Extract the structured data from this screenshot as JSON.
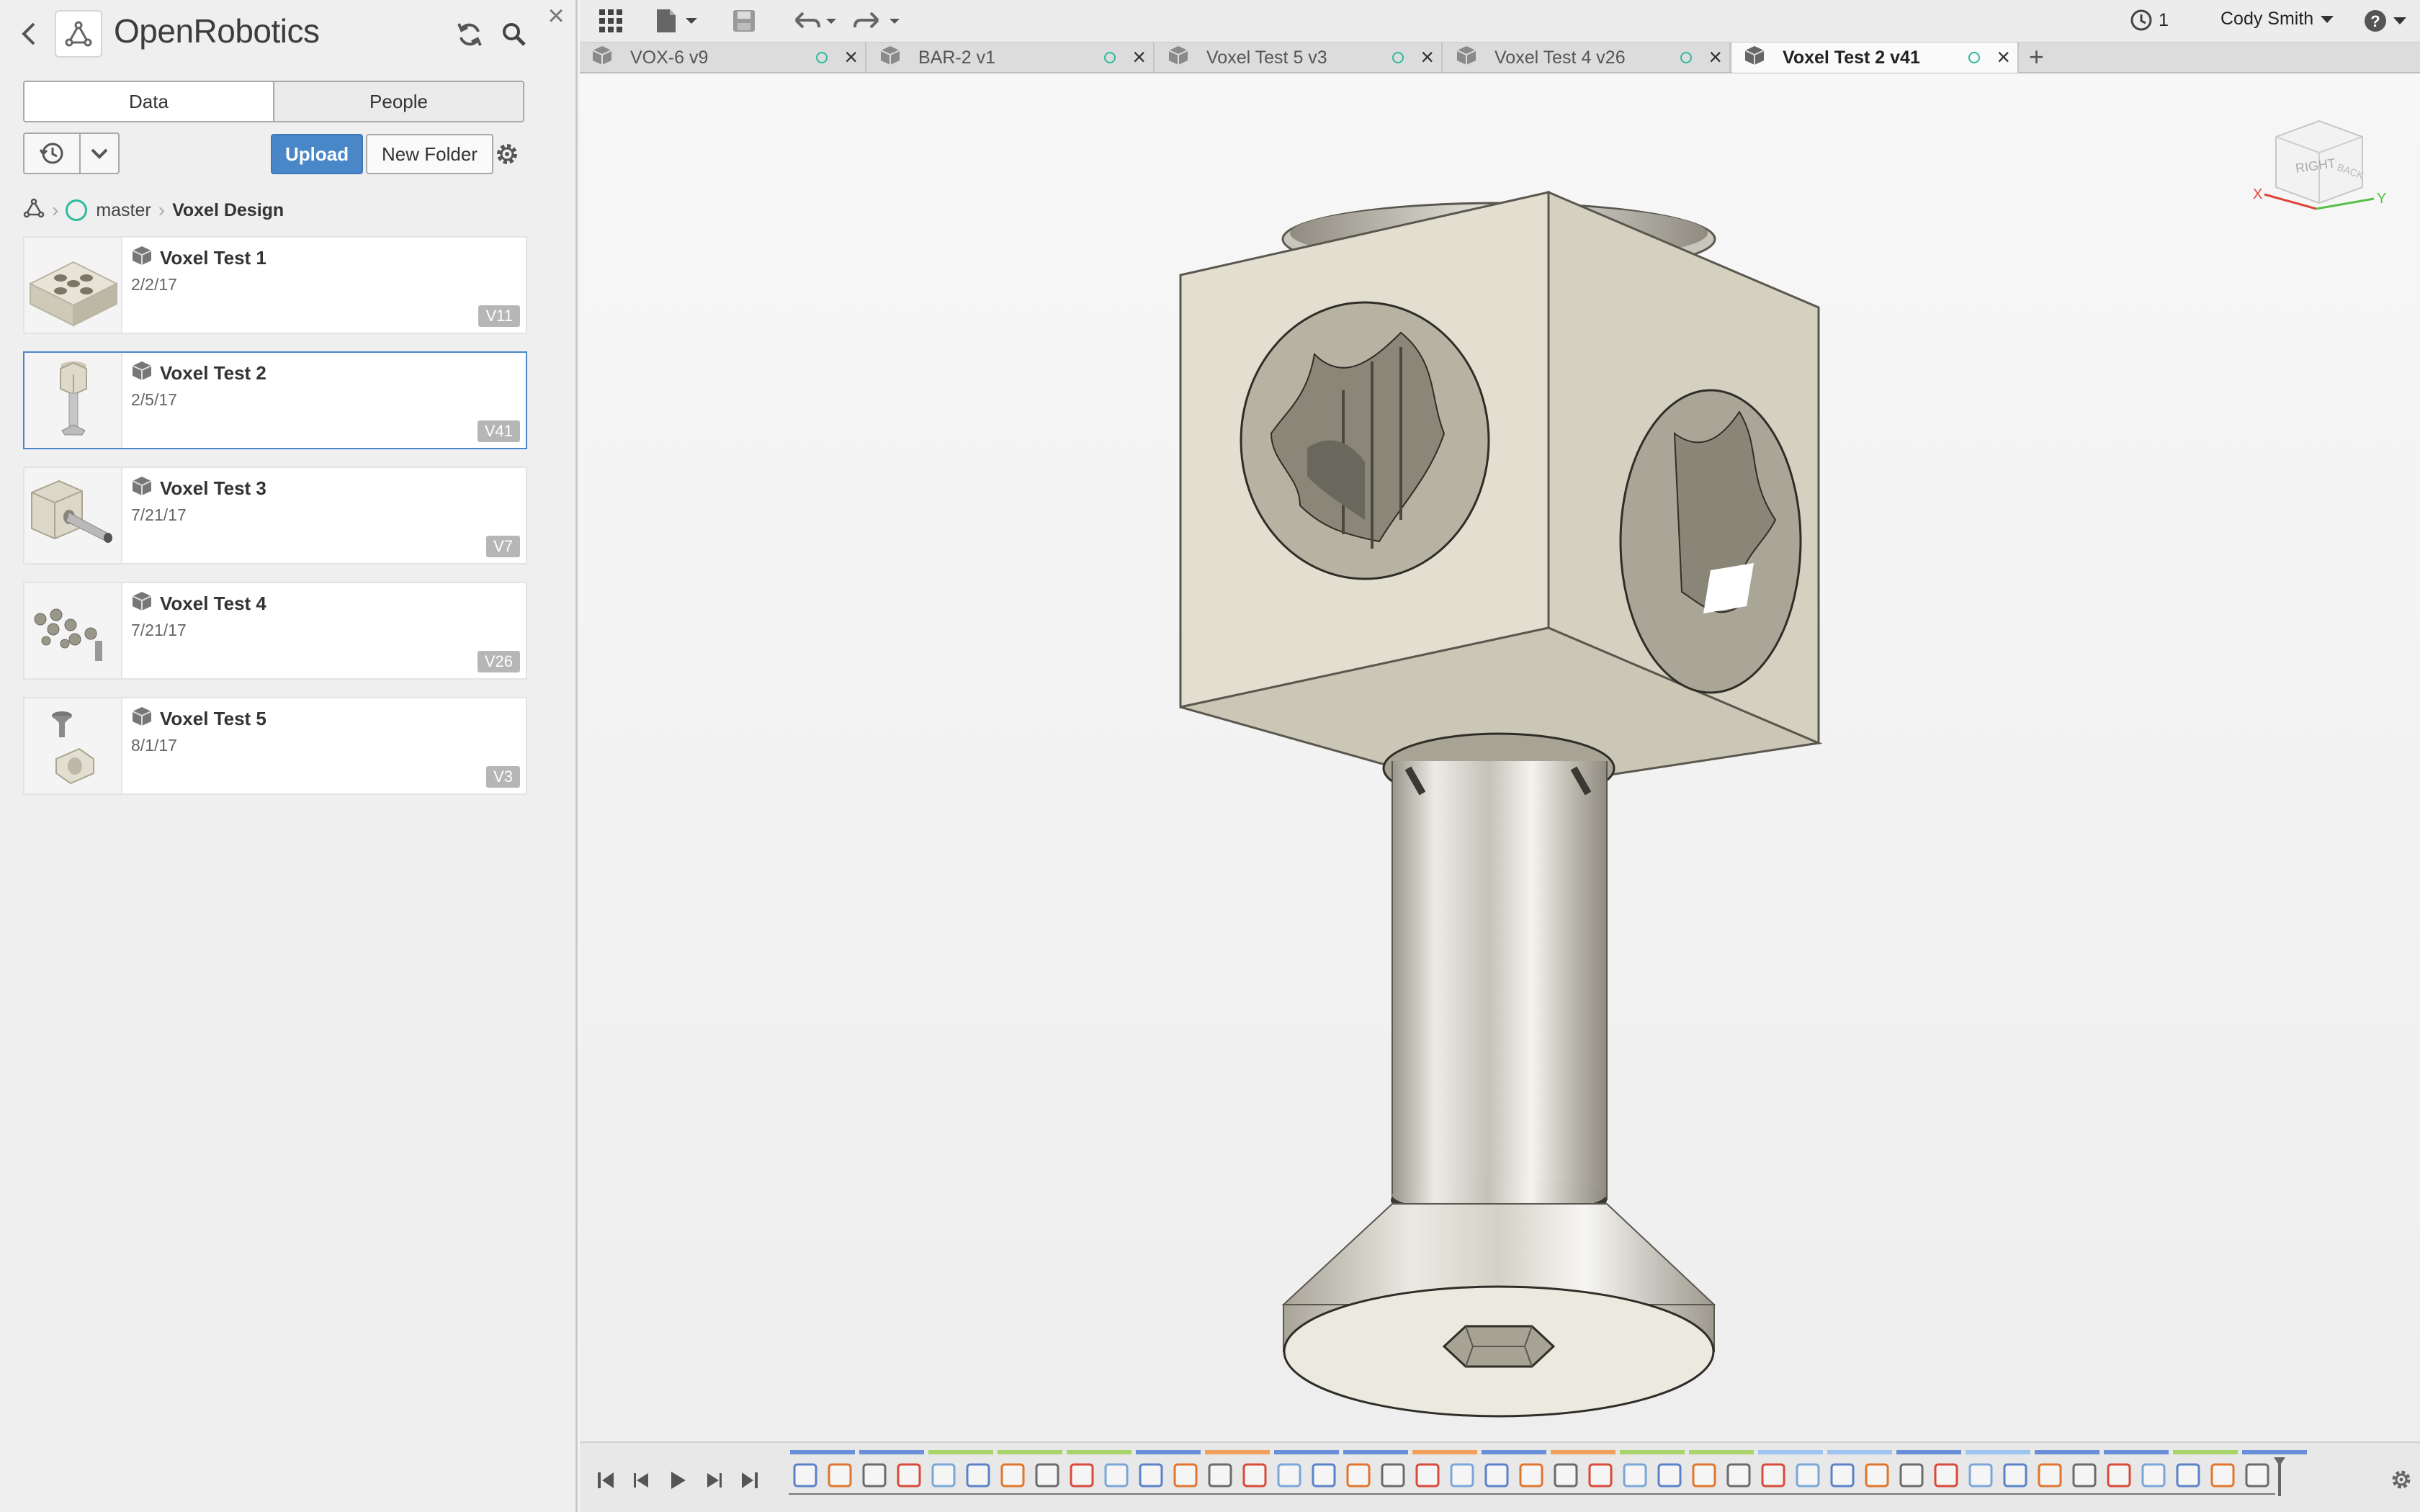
{
  "panel": {
    "hub_name": "OpenRobotics",
    "tabs": {
      "data": "Data",
      "people": "People"
    },
    "upload_label": "Upload",
    "new_folder_label": "New Folder",
    "breadcrumb": {
      "project": "master",
      "folder": "Voxel Design"
    },
    "files": [
      {
        "name": "Voxel Test 1",
        "date": "2/2/17",
        "version": "V11"
      },
      {
        "name": "Voxel Test 2",
        "date": "2/5/17",
        "version": "V41"
      },
      {
        "name": "Voxel Test 3",
        "date": "7/21/17",
        "version": "V7"
      },
      {
        "name": "Voxel Test 4",
        "date": "7/21/17",
        "version": "V26"
      },
      {
        "name": "Voxel Test 5",
        "date": "8/1/17",
        "version": "V3"
      }
    ]
  },
  "appbar": {
    "jobs_count": "1",
    "user_name": "Cody Smith"
  },
  "tabs": [
    {
      "label": "VOX-6 v9"
    },
    {
      "label": "BAR-2 v1"
    },
    {
      "label": "Voxel Test 5 v3"
    },
    {
      "label": "Voxel Test 4 v26"
    },
    {
      "label": "Voxel Test 2 v41",
      "active": true
    }
  ],
  "viewcube": {
    "face_right": "RIGHT",
    "face_back": "BACK",
    "axis_x": "X",
    "axis_y": "Y"
  },
  "colors": {
    "accent": "#4a87c8",
    "status": "#2dbb9c",
    "model": "#e8e4d6"
  }
}
